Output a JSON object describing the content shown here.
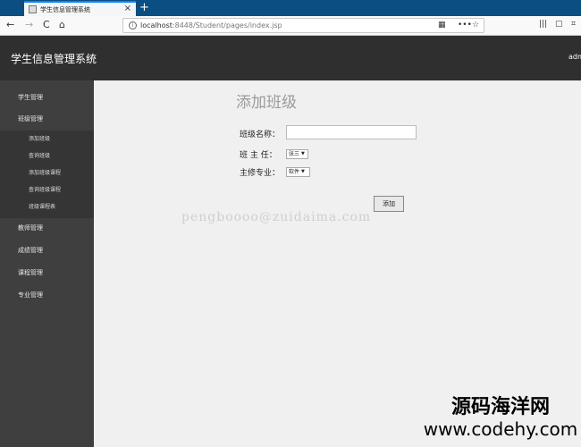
{
  "browser": {
    "tab_title": "学生信息管理系统",
    "tab_close": "×",
    "new_tab": "+",
    "url_host": "localhost",
    "url_path": ":8448/Student/pages/index.jsp",
    "url_more": "•••",
    "back_icon": "←",
    "forward_icon": "→",
    "reload_icon": "C",
    "home_icon": "⌂",
    "qr_icon": "▦",
    "bookmark_icon": "☆",
    "library_icon": "|||",
    "sidebar_icon": "▢",
    "crop_icon": "⌗"
  },
  "header": {
    "title": "学生信息管理系统",
    "user": "adm"
  },
  "sidebar": {
    "items": [
      {
        "label": "学生管理"
      },
      {
        "label": "班级管理"
      },
      {
        "label": "教师管理"
      },
      {
        "label": "成绩管理"
      },
      {
        "label": "课程管理"
      },
      {
        "label": "专业管理"
      }
    ],
    "sub_items": [
      {
        "label": "添加班级"
      },
      {
        "label": "查询班级"
      },
      {
        "label": "添加班级课程"
      },
      {
        "label": "查询班级课程"
      },
      {
        "label": "班级课程表"
      }
    ]
  },
  "form": {
    "title": "添加班级",
    "class_name_label": "班级名称：",
    "class_name_value": "",
    "teacher_label": "班 主 任：",
    "teacher_value": "张三",
    "major_label": "主修专业：",
    "major_value": "软件",
    "submit_label": "添加"
  },
  "overlay": {
    "watermark": "pengboooo@zuidaima.com",
    "brand_line1": "源码海洋网",
    "brand_line2": "www.codehy.com"
  }
}
